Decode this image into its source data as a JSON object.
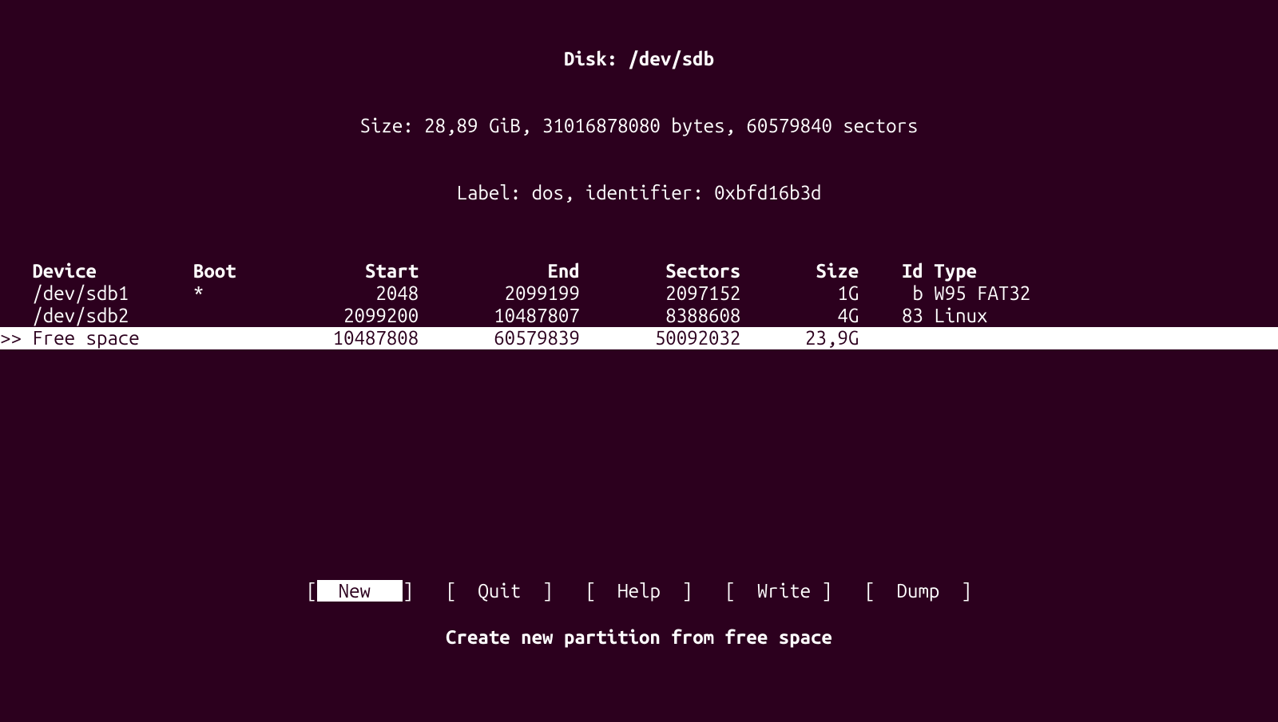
{
  "header": {
    "disk_label": "Disk: ",
    "disk_path": "/dev/sdb",
    "size_line": "Size: 28,89 GiB, 31016878080 bytes, 60579840 sectors",
    "label_line": "Label: dos, identifier: 0xbfd16b3d"
  },
  "columns": {
    "device": "Device",
    "boot": "Boot",
    "start": "Start",
    "end": "End",
    "sectors": "Sectors",
    "size": "Size",
    "id": "Id",
    "type": "Type"
  },
  "rows": [
    {
      "marker": "   ",
      "device": "/dev/sdb1",
      "boot": "*",
      "start": "2048",
      "end": "2099199",
      "sectors": "2097152",
      "size": "1G",
      "id": "b",
      "type": "W95 FAT32",
      "selected": false
    },
    {
      "marker": "   ",
      "device": "/dev/sdb2",
      "boot": "",
      "start": "2099200",
      "end": "10487807",
      "sectors": "8388608",
      "size": "4G",
      "id": "83",
      "type": "Linux",
      "selected": false
    },
    {
      "marker": ">> ",
      "device": "Free space",
      "boot": "",
      "start": "10487808",
      "end": "60579839",
      "sectors": "50092032",
      "size": "23,9G",
      "id": "",
      "type": "",
      "selected": true
    }
  ],
  "menu": {
    "items": [
      {
        "label": "New",
        "selected": true
      },
      {
        "label": "Quit",
        "selected": false
      },
      {
        "label": "Help",
        "selected": false
      },
      {
        "label": "Write",
        "selected": false
      },
      {
        "label": "Dump",
        "selected": false
      }
    ]
  },
  "hint": "Create new partition from free space"
}
